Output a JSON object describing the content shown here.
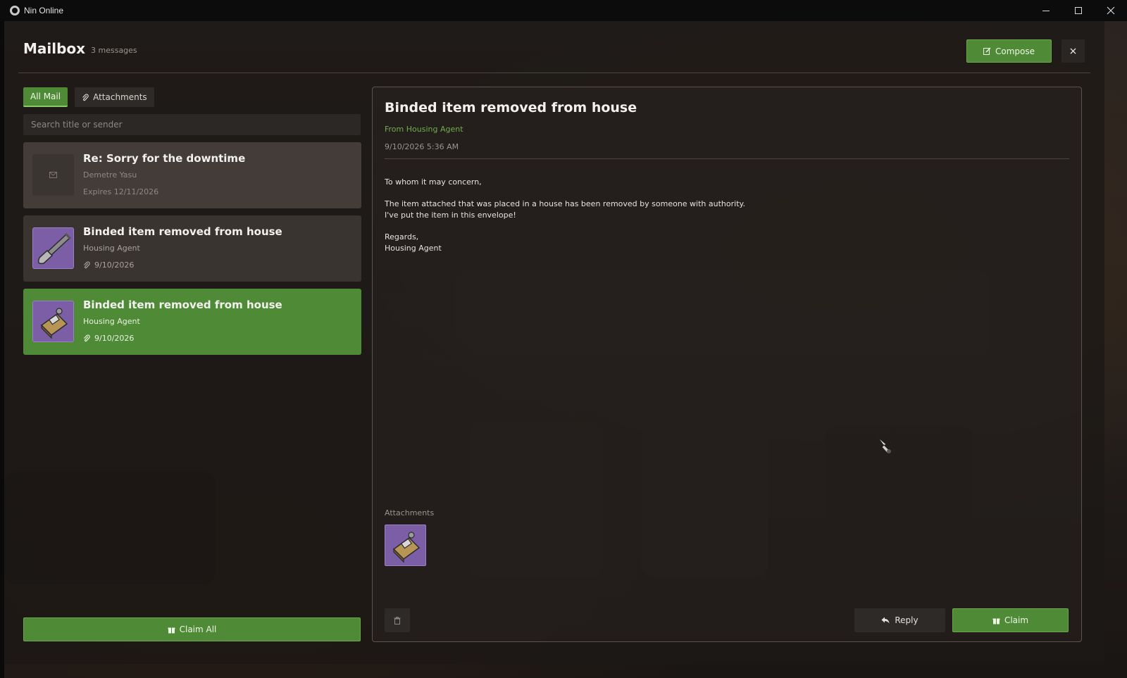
{
  "window": {
    "title": "Nin Online"
  },
  "mailbox": {
    "title": "Mailbox",
    "count": "3 messages",
    "compose_label": "Compose",
    "close_label": "×"
  },
  "tabs": [
    {
      "label": "All Mail",
      "active": true
    },
    {
      "label": "Attachments",
      "active": false
    }
  ],
  "search": {
    "placeholder": "Search title or sender",
    "value": ""
  },
  "mails": [
    {
      "subject": "Re: Sorry for the downtime",
      "sender": "Demetre Yasu",
      "meta": "Expires 12/11/2026",
      "icon": "envelope-icon",
      "has_attachment": false,
      "state": "read"
    },
    {
      "subject": "Binded item removed from house",
      "sender": "Housing Agent",
      "meta": "9/10/2026",
      "icon": "shovel-icon",
      "has_attachment": true,
      "state": "unread"
    },
    {
      "subject": "Binded item removed from house",
      "sender": "Housing Agent",
      "meta": "9/10/2026",
      "icon": "tool-box-icon",
      "has_attachment": true,
      "state": "selected"
    }
  ],
  "claim_all_label": "Claim All",
  "detail": {
    "title": "Binded item removed from house",
    "from": "From Housing Agent",
    "date": "9/10/2026 5:36 AM",
    "body": {
      "greeting": "To whom it may concern,",
      "line1": "The item attached that was placed in a house has been removed by someone with authority.",
      "line2": "I've put the item in this envelope!",
      "closing": "Regards,",
      "signature": "Housing Agent"
    },
    "attachments_label": "Attachments",
    "reply_label": "Reply",
    "claim_label": "Claim"
  },
  "colors": {
    "accent": "#4f8b36",
    "from_green": "#6fae4d",
    "slot_purple": "#7b5ea6"
  }
}
